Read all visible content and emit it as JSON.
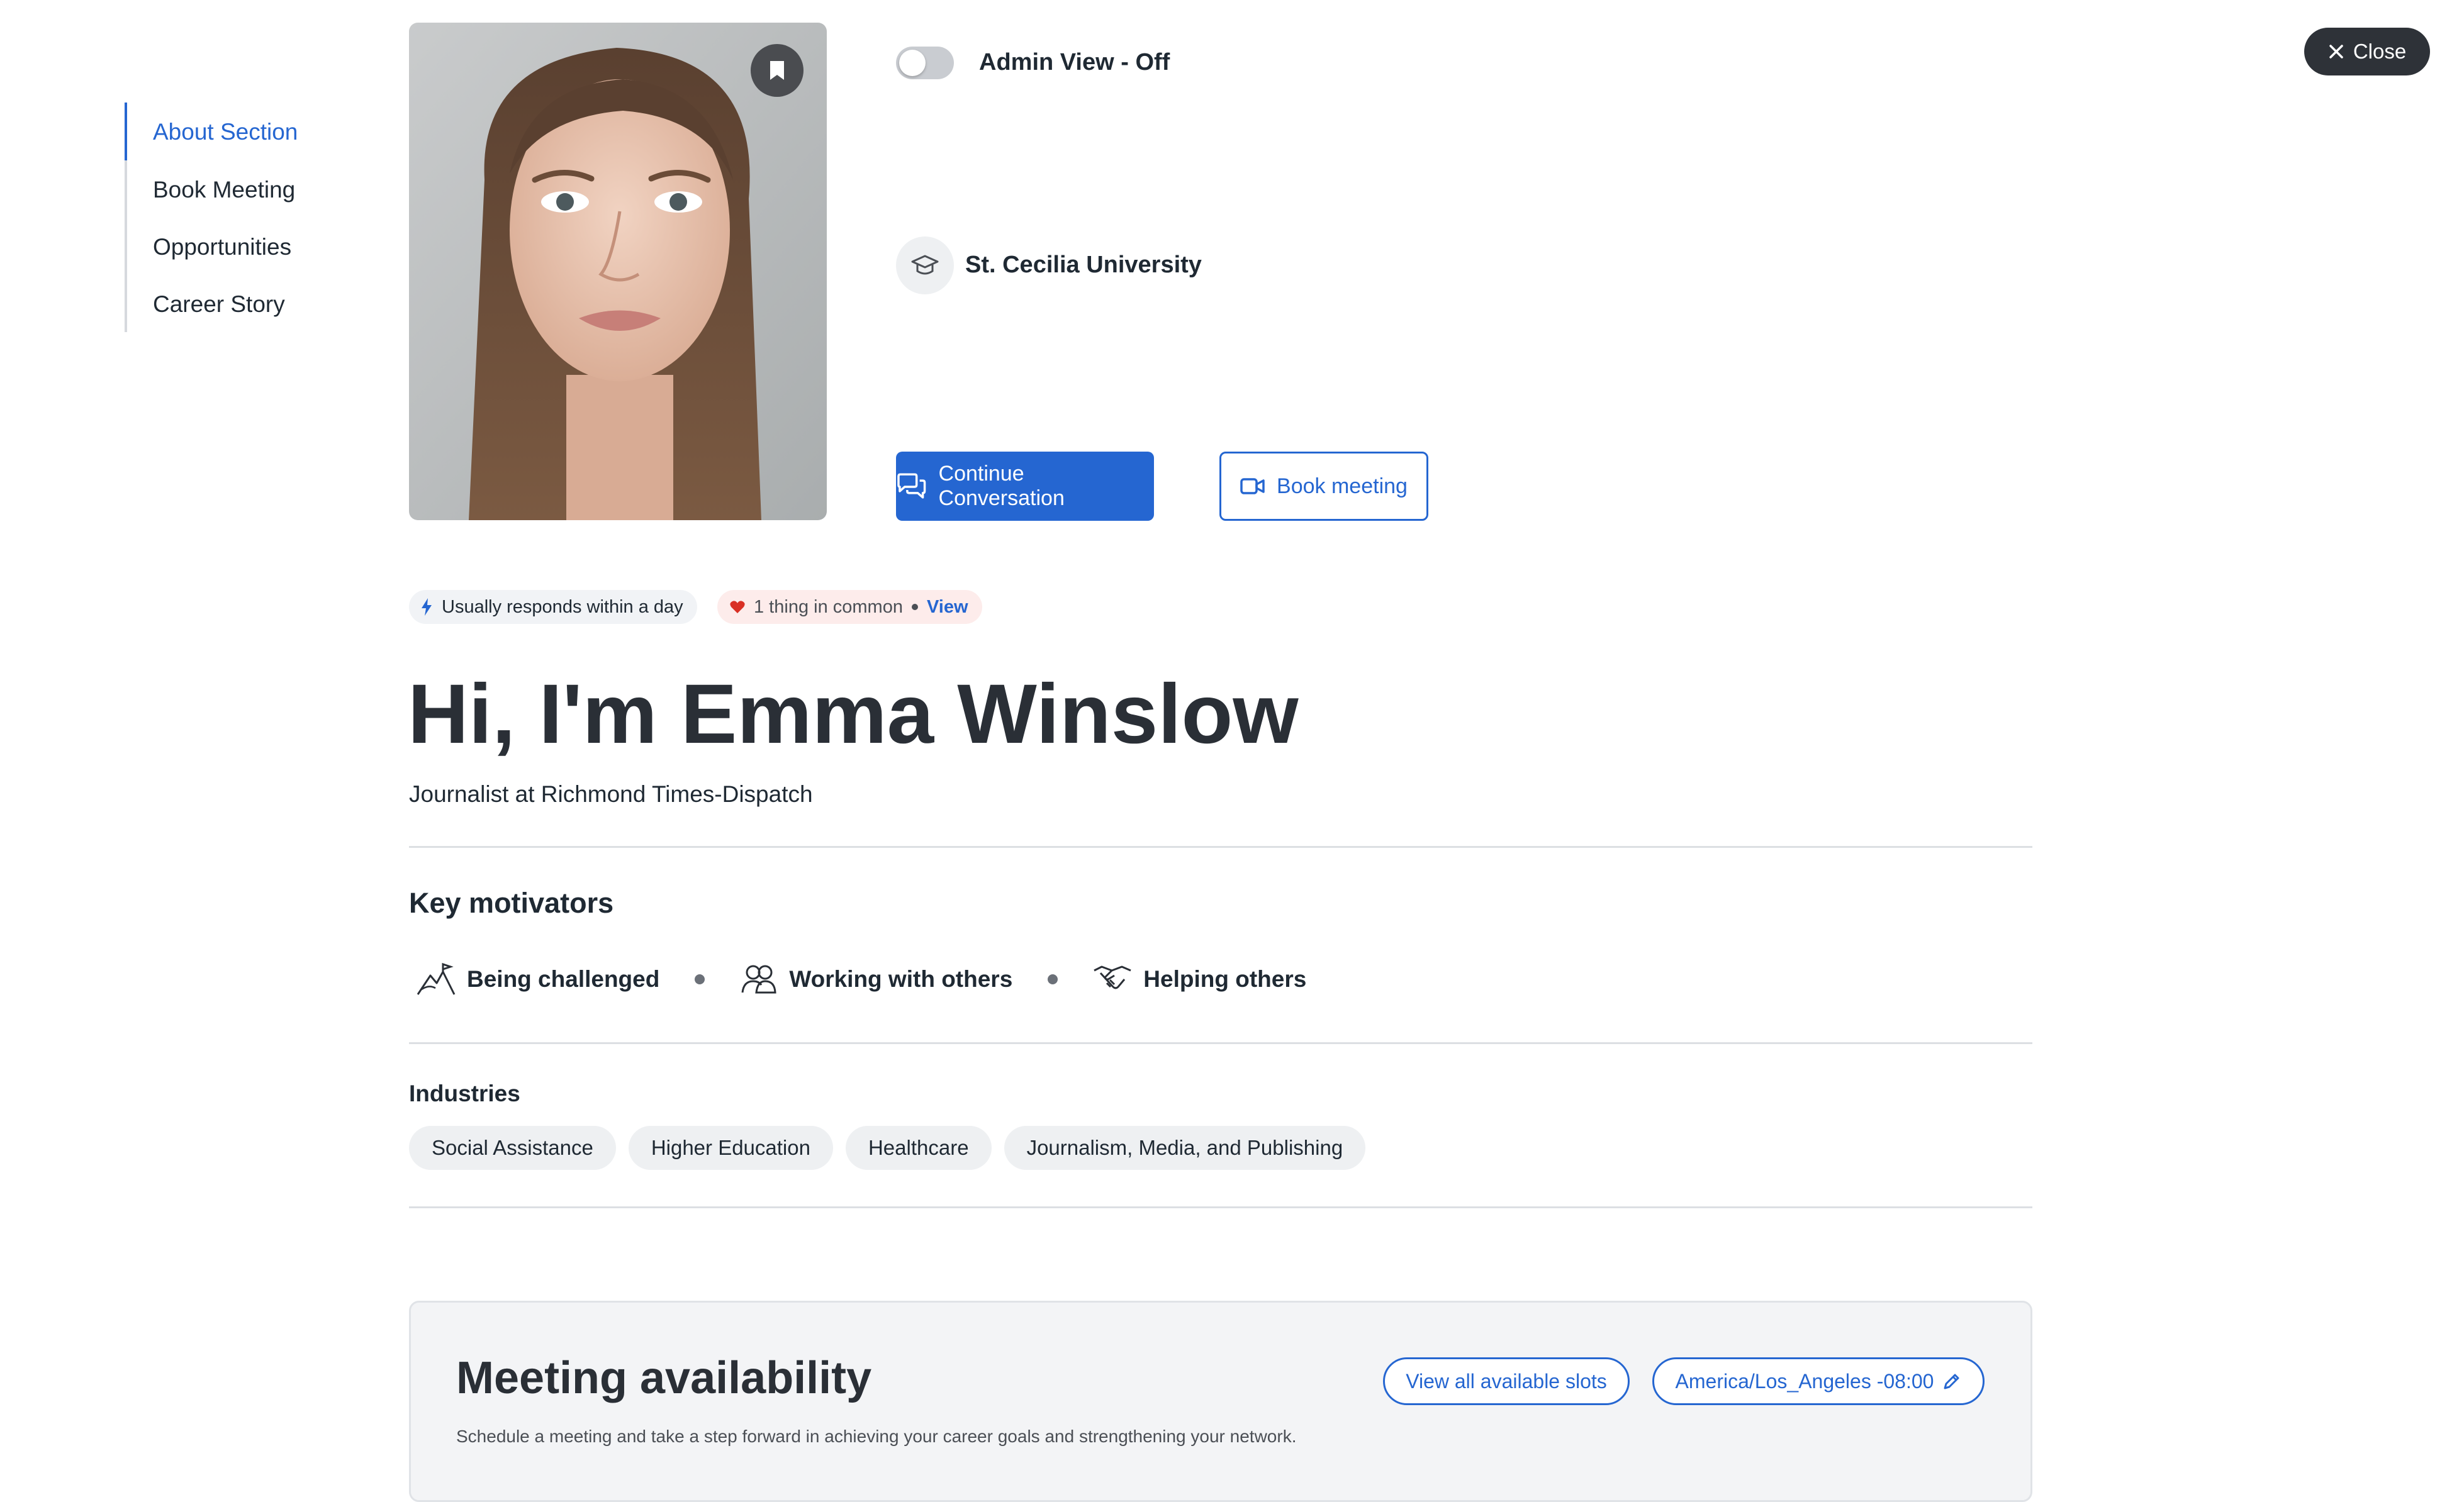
{
  "nav": {
    "items": [
      {
        "label": "About Section",
        "active": true
      },
      {
        "label": "Book Meeting",
        "active": false
      },
      {
        "label": "Opportunities",
        "active": false
      },
      {
        "label": "Career Story",
        "active": false
      }
    ]
  },
  "profile": {
    "photo_alt": "profile-photo",
    "admin_view_label": "Admin View - Off",
    "admin_view_on": false,
    "university": "St. Cecilia University"
  },
  "actions": {
    "continue_label": "Continue Conversation",
    "book_label": "Book meeting"
  },
  "chips": {
    "responds": "Usually responds within a day",
    "common": "1 thing in common",
    "common_link": "View"
  },
  "headline": "Hi, I'm Emma Winslow",
  "subtitle": "Journalist at Richmond Times-Dispatch",
  "motivators": {
    "title": "Key motivators",
    "items": [
      {
        "label": "Being challenged",
        "icon": "mountain-icon"
      },
      {
        "label": "Working with others",
        "icon": "people-icon"
      },
      {
        "label": "Helping others",
        "icon": "handshake-icon"
      }
    ]
  },
  "industries": {
    "title": "Industries",
    "items": [
      "Social Assistance",
      "Higher Education",
      "Healthcare",
      "Journalism, Media, and Publishing"
    ]
  },
  "meeting": {
    "title": "Meeting availability",
    "description": "Schedule a meeting and take a step forward in achieving your career goals and strengthening your network.",
    "view_slots_label": "View all available slots",
    "timezone_label": "America/Los_Angeles -08:00"
  },
  "close_label": "Close",
  "colors": {
    "accent": "#2566d1",
    "dark": "#2e3238",
    "heart": "#d93025"
  }
}
